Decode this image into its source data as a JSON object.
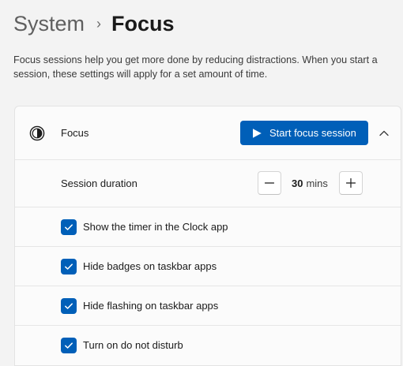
{
  "breadcrumb": {
    "parent": "System",
    "separator": "›",
    "current": "Focus"
  },
  "description": "Focus sessions help you get more done by reducing distractions. When you start a session, these settings will apply for a set amount of time.",
  "focus_card": {
    "label": "Focus",
    "icon": "focus-icon",
    "start_button_label": "Start focus session",
    "start_button_icon": "play-icon",
    "collapse_icon": "chevron-up-icon",
    "accent_color": "#005fb8"
  },
  "session_duration": {
    "label": "Session duration",
    "value": "30",
    "unit": "mins",
    "decrement_icon": "minus-icon",
    "increment_icon": "plus-icon"
  },
  "options": [
    {
      "label": "Show the timer in the Clock app",
      "checked": true
    },
    {
      "label": "Hide badges on taskbar apps",
      "checked": true
    },
    {
      "label": "Hide flashing on taskbar apps",
      "checked": true
    },
    {
      "label": "Turn on do not disturb",
      "checked": true
    }
  ]
}
